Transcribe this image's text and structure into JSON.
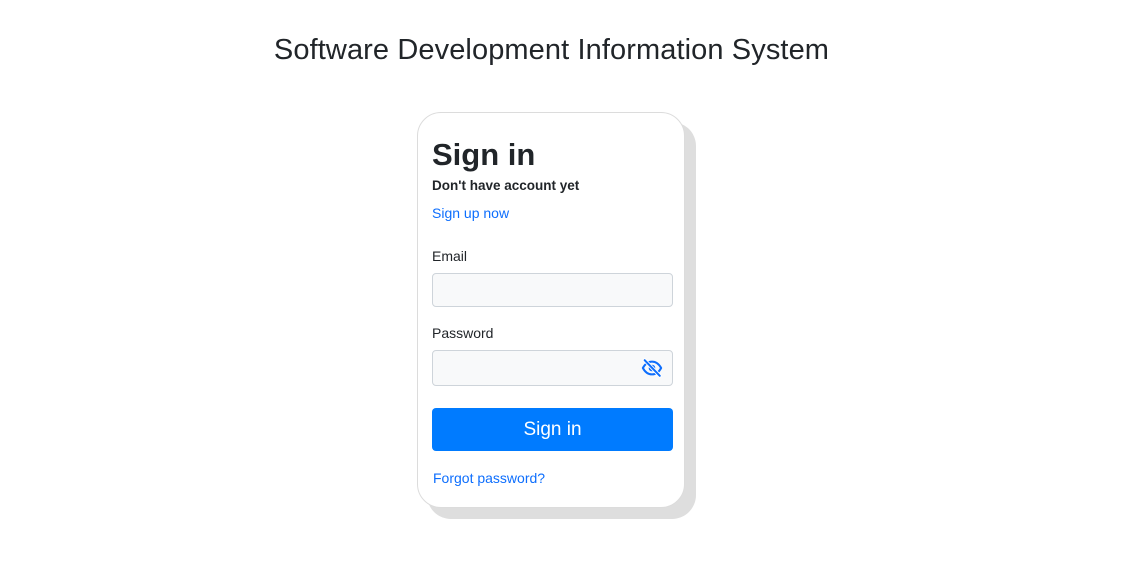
{
  "page": {
    "title": "Software Development Information System"
  },
  "login": {
    "heading": "Sign in",
    "subheading": "Don't have account yet",
    "signup_link": "Sign up now",
    "email": {
      "label": "Email",
      "value": "",
      "placeholder": ""
    },
    "password": {
      "label": "Password",
      "value": "",
      "placeholder": "",
      "toggle_icon": "eye-slash-icon"
    },
    "submit_label": "Sign in",
    "forgot_link": "Forgot password?"
  },
  "colors": {
    "primary": "#007bff",
    "link": "#0d6efd",
    "input_bg": "#f8f9fa",
    "card_shadow": "#dedede"
  }
}
